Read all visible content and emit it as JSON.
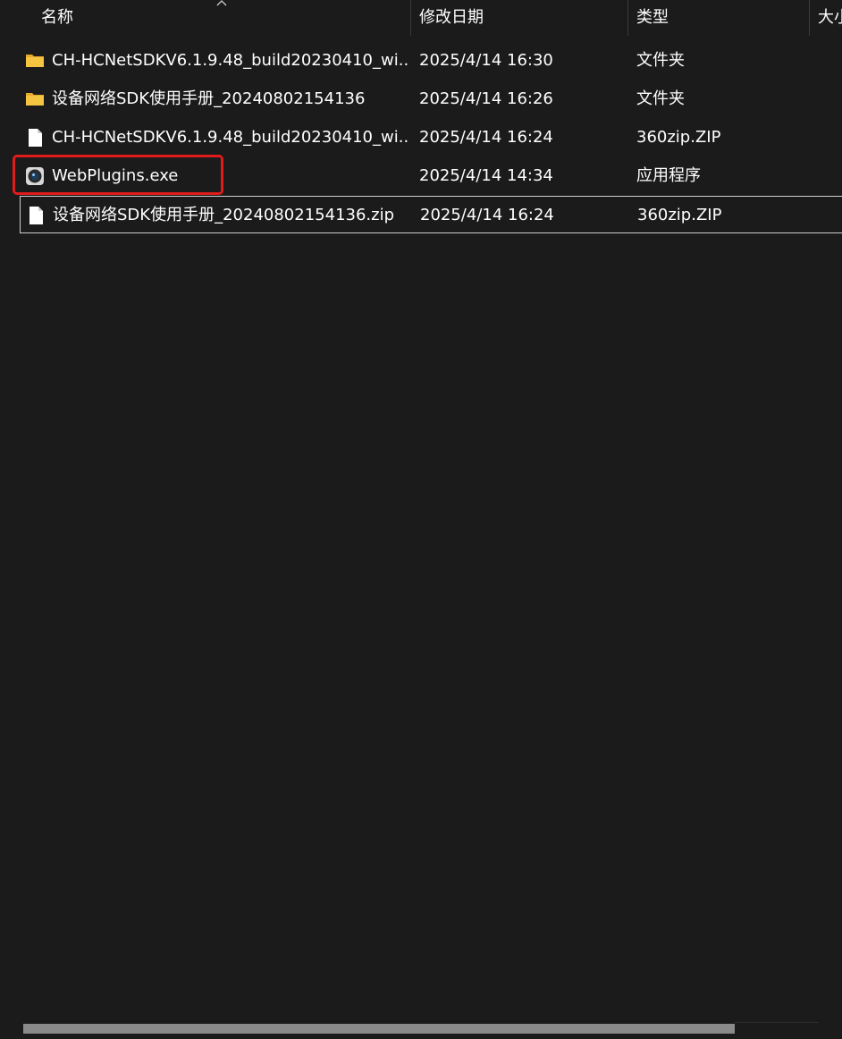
{
  "columns": {
    "name": "名称",
    "date": "修改日期",
    "type": "类型",
    "size": "大小"
  },
  "files": [
    {
      "name": "CH-HCNetSDKV6.1.9.48_build20230410_wi...",
      "date": "2025/4/14 16:30",
      "type": "文件夹",
      "icon": "folder-icon"
    },
    {
      "name": "设备网络SDK使用手册_20240802154136",
      "date": "2025/4/14 16:26",
      "type": "文件夹",
      "icon": "folder-icon"
    },
    {
      "name": "CH-HCNetSDKV6.1.9.48_build20230410_wi...",
      "date": "2025/4/14 16:24",
      "type": "360zip.ZIP",
      "icon": "document-icon"
    },
    {
      "name": "WebPlugins.exe",
      "date": "2025/4/14 14:34",
      "type": "应用程序",
      "icon": "app-camera-icon"
    },
    {
      "name": "设备网络SDK使用手册_20240802154136.zip",
      "date": "2025/4/14 16:24",
      "type": "360zip.ZIP",
      "icon": "document-icon"
    }
  ],
  "colors": {
    "background": "#1b1b1b",
    "folder": "#f5c542",
    "highlight": "#e01b1b",
    "text": "#ffffff"
  },
  "horizontal_scroll_position": 0
}
